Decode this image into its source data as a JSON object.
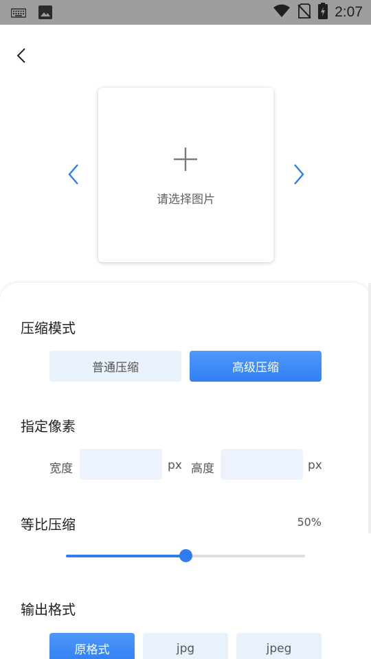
{
  "status_bar": {
    "time": "2:07",
    "icons": [
      "keyboard-icon",
      "image-icon",
      "wifi-icon",
      "no-sim-icon",
      "battery-charging-icon"
    ]
  },
  "nav": {
    "back_icon": "chevron-left-icon"
  },
  "picker": {
    "label": "请选择图片",
    "prev_icon": "chevron-left-icon",
    "next_icon": "chevron-right-icon",
    "add_icon": "plus-icon"
  },
  "compress_mode": {
    "title": "压缩模式",
    "options": [
      "普通压缩",
      "高级压缩"
    ],
    "selected": "高级压缩"
  },
  "pixels": {
    "title": "指定像素",
    "width_label": "宽度",
    "width_value": "",
    "width_unit": "px",
    "height_label": "高度",
    "height_value": "",
    "height_unit": "px"
  },
  "ratio": {
    "title": "等比压缩",
    "value_text": "50%",
    "value": 50
  },
  "output": {
    "title": "输出格式",
    "options": [
      "原格式",
      "jpg",
      "jpeg"
    ],
    "selected": "原格式"
  },
  "colors": {
    "accent": "#2f7cf0",
    "button_off": "#e9f1fd",
    "status_bar": "#9e9e9e"
  }
}
